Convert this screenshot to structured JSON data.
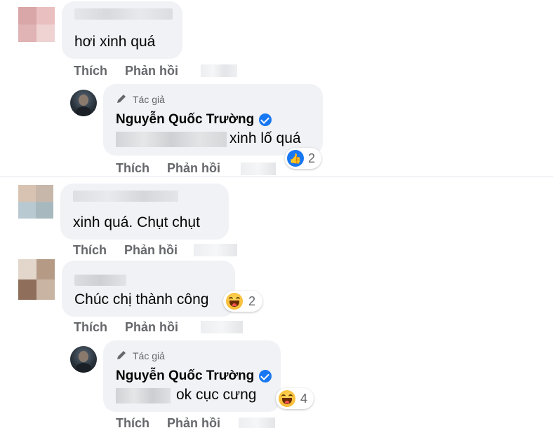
{
  "colors": {
    "bubble": "#f0f2f5",
    "action_text": "#65676b",
    "verified": "#1877f2",
    "like": "#1877f2"
  },
  "actions": {
    "like": "Thích",
    "reply": "Phản hồi"
  },
  "author_badge": "Tác giả",
  "comments": [
    {
      "text": "hơi xinh quá"
    },
    {
      "author": "Nguyễn Quốc Trường",
      "text": "xinh lố quá",
      "reaction": {
        "icon": "like-icon",
        "count": "2"
      }
    },
    {
      "text": "xinh quá. Chụt chụt"
    },
    {
      "text": "Chúc chị thành công",
      "reaction": {
        "icon": "haha-icon",
        "count": "2"
      }
    },
    {
      "author": "Nguyễn Quốc Trường",
      "text": "ok cục cưng",
      "reaction": {
        "icon": "haha-icon",
        "count": "4"
      }
    }
  ]
}
